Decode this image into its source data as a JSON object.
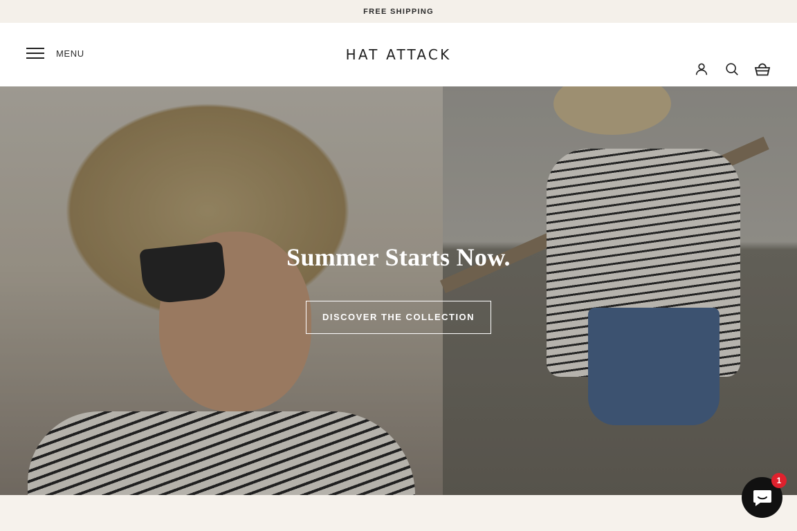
{
  "announcement": {
    "text": "FREE SHIPPING"
  },
  "header": {
    "menu_label": "MENU",
    "logo": "HAT ATTACK",
    "icons": [
      "account-icon",
      "search-icon",
      "cart-icon"
    ]
  },
  "hero": {
    "title": "Summer Starts Now.",
    "cta_label": "DISCOVER THE COLLECTION"
  },
  "chat": {
    "badge_count": "1",
    "badge_color": "#e0212d"
  }
}
